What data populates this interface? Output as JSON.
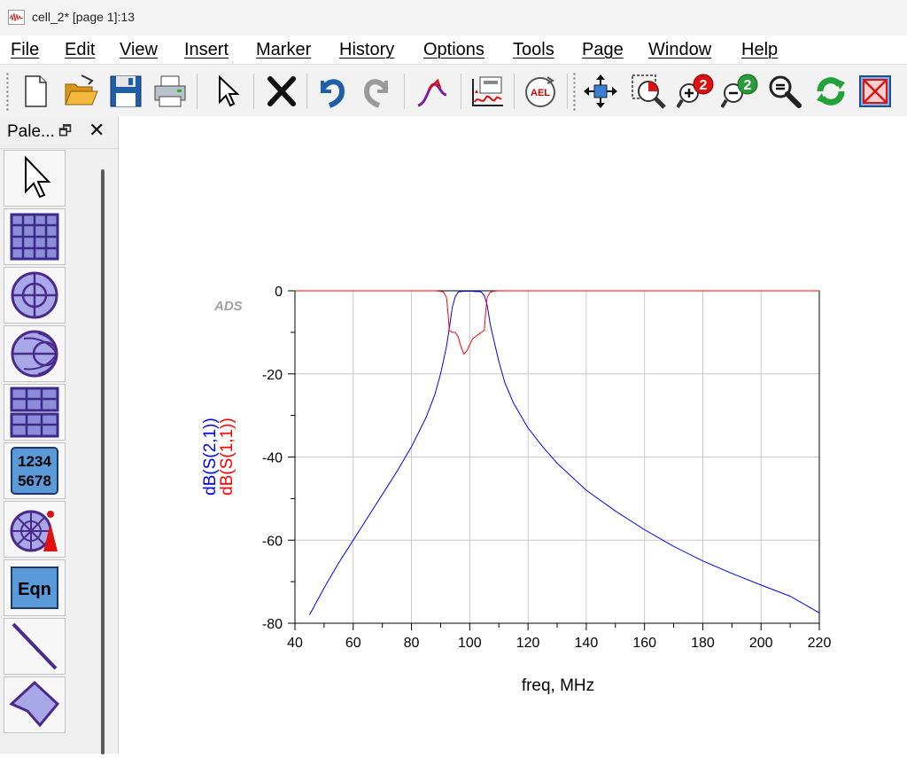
{
  "window": {
    "title": "cell_2* [page 1]:13",
    "icon": "waveform-app-icon"
  },
  "menu": [
    "File",
    "Edit",
    "View",
    "Insert",
    "Marker",
    "History",
    "Options",
    "Tools",
    "Page",
    "Window",
    "Help"
  ],
  "toolbar": {
    "buttons": [
      "new-document-icon",
      "open-folder-icon",
      "save-icon",
      "print-icon",
      "select-pointer-icon",
      "delete-icon",
      "undo-icon",
      "redo-icon",
      "trace-icon",
      "plot-data-icon",
      "ael-icon",
      "pan-icon",
      "zoom-area-icon",
      "zoom-in-icon",
      "zoom-out-icon",
      "zoom-fit-icon",
      "redraw-icon",
      "clear-view-icon"
    ],
    "ael_label": "AEL"
  },
  "palette": {
    "title": "Pale...",
    "tools": [
      "pointer-tool-icon",
      "rectangular-plot-icon",
      "polar-plot-icon",
      "smith-chart-icon",
      "stacked-plot-icon",
      "list-icon",
      "antenna-plot-icon",
      "equation-icon",
      "line-icon",
      "polygon-icon"
    ],
    "list_label_1": "1234",
    "list_label_2": "5678",
    "equation_label": "Eqn"
  },
  "plot": {
    "watermark": "ADS"
  },
  "chart_data": {
    "type": "line",
    "xlabel": "freq, MHz",
    "ylabel": "",
    "xlim": [
      40,
      220
    ],
    "ylim": [
      -80,
      0
    ],
    "xticks": [
      40,
      60,
      80,
      100,
      120,
      140,
      160,
      180,
      200,
      220
    ],
    "yticks": [
      0,
      -20,
      -40,
      -60,
      -80
    ],
    "grid": true,
    "series": [
      {
        "name": "dB(S(2,1))",
        "color": "#0000ff",
        "x": [
          45,
          50,
          55,
          60,
          65,
          70,
          75,
          80,
          85,
          88,
          90,
          92,
          93,
          94,
          95,
          96,
          97,
          98,
          99,
          100,
          101,
          102,
          103,
          104,
          105,
          106,
          107,
          108,
          110,
          112,
          115,
          120,
          125,
          130,
          140,
          150,
          160,
          170,
          180,
          190,
          200,
          210,
          220
        ],
        "y": [
          -78,
          -71.5,
          -65.5,
          -60,
          -54.5,
          -49,
          -43.5,
          -37.5,
          -30.5,
          -25,
          -20,
          -13.5,
          -9,
          -4,
          -1.5,
          -0.3,
          -0.2,
          -0.1,
          -0.1,
          -0.1,
          -0.1,
          -0.2,
          -0.2,
          -0.3,
          -1.2,
          -3.5,
          -8,
          -11,
          -17,
          -22,
          -27,
          -33,
          -37.5,
          -41.5,
          -48,
          -53,
          -57.5,
          -61.5,
          -65,
          -68,
          -70.8,
          -73.5,
          -77.5
        ]
      },
      {
        "name": "dB(S(1,1))",
        "color": "#ff0000",
        "x": [
          40,
          88,
          90,
          91,
          92,
          92.5,
          93,
          94,
          95,
          96,
          97,
          98,
          99,
          100,
          101,
          102,
          103,
          104,
          105,
          105.5,
          106,
          107,
          108,
          110,
          112,
          220
        ],
        "y": [
          0,
          0,
          -0.1,
          -0.3,
          -1.5,
          -5,
          -9.5,
          -10,
          -10,
          -11,
          -13.5,
          -15.2,
          -14.5,
          -13,
          -11.5,
          -11,
          -10.5,
          -10,
          -9.5,
          -5,
          -1.5,
          -0.4,
          -0.1,
          0,
          0,
          0
        ]
      }
    ]
  }
}
